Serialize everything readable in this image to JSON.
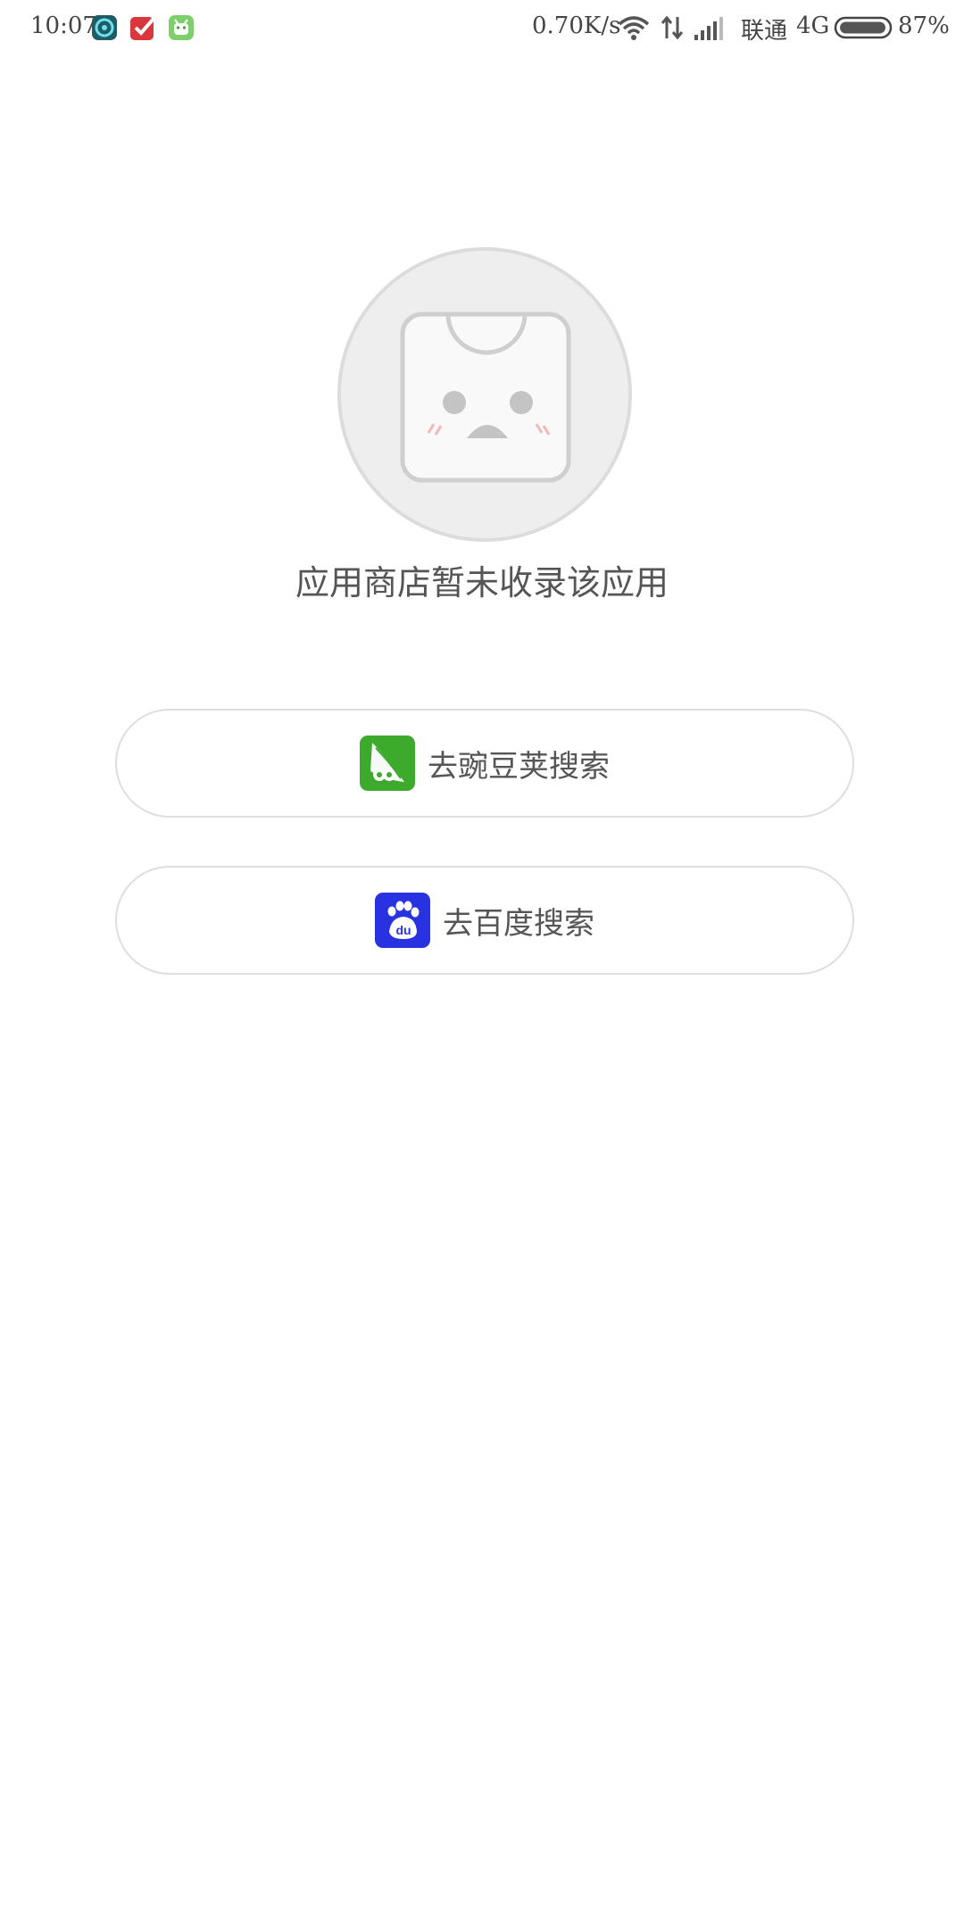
{
  "status_bar": {
    "time": "10:07",
    "network_speed": "0.70K/s",
    "carrier": "联通",
    "network_type": "4G",
    "battery": "87%",
    "icons": [
      "app-circle-icon",
      "todo-check-icon",
      "android-green-icon",
      "wifi-icon",
      "data-arrows-icon",
      "signal-icon",
      "battery-icon"
    ]
  },
  "empty_state": {
    "icon": "sad-shopping-bag-icon",
    "message": "应用商店暂未收录该应用"
  },
  "actions": [
    {
      "label": "去豌豆荚搜索",
      "icon": "wandoujia-icon",
      "color": "#3daa2e"
    },
    {
      "label": "去百度搜索",
      "icon": "baidu-icon",
      "color": "#2932e1"
    }
  ]
}
